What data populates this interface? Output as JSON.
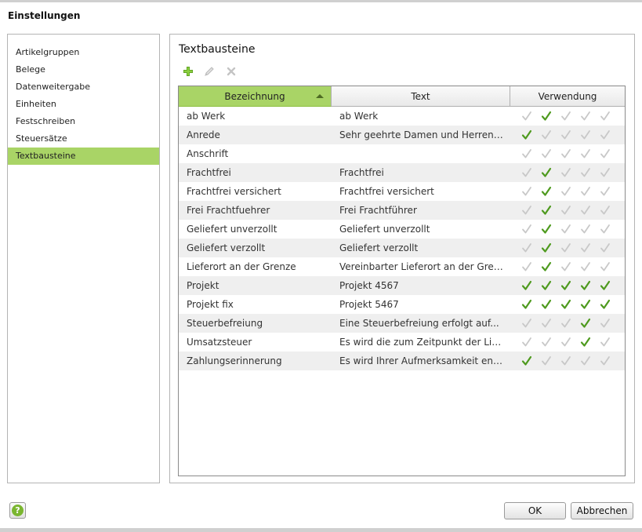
{
  "window": {
    "title": "Einstellungen"
  },
  "nav": {
    "items": [
      {
        "label": "Artikelgruppen",
        "active": false
      },
      {
        "label": "Belege",
        "active": false
      },
      {
        "label": "Datenweitergabe",
        "active": false
      },
      {
        "label": "Einheiten",
        "active": false
      },
      {
        "label": "Festschreiben",
        "active": false
      },
      {
        "label": "Steuersätze",
        "active": false
      },
      {
        "label": "Textbausteine",
        "active": true
      }
    ]
  },
  "section": {
    "title": "Textbausteine"
  },
  "toolbar": {
    "add_icon": "plus-icon",
    "edit_icon": "pencil-icon",
    "delete_icon": "x-icon"
  },
  "table": {
    "columns": [
      {
        "label": "Bezeichnung",
        "sorted": "asc"
      },
      {
        "label": "Text"
      },
      {
        "label": "Verwendung"
      }
    ],
    "rows": [
      {
        "name": "ab Werk",
        "text": "ab Werk",
        "usage": [
          false,
          true,
          false,
          false,
          false
        ]
      },
      {
        "name": "Anrede",
        "text": "Sehr geehrte Damen und Herren,...",
        "usage": [
          true,
          false,
          false,
          false,
          false
        ]
      },
      {
        "name": "Anschrift",
        "text": "",
        "usage": [
          false,
          false,
          false,
          false,
          false
        ]
      },
      {
        "name": "Frachtfrei",
        "text": "Frachtfrei",
        "usage": [
          false,
          true,
          false,
          false,
          false
        ]
      },
      {
        "name": "Frachtfrei versichert",
        "text": "Frachtfrei versichert",
        "usage": [
          false,
          true,
          false,
          false,
          false
        ]
      },
      {
        "name": "Frei Frachtfuehrer",
        "text": "Frei Frachtführer",
        "usage": [
          false,
          true,
          false,
          false,
          false
        ]
      },
      {
        "name": "Geliefert unverzollt",
        "text": "Geliefert unverzollt",
        "usage": [
          false,
          true,
          false,
          false,
          false
        ]
      },
      {
        "name": "Geliefert verzollt",
        "text": "Geliefert verzollt",
        "usage": [
          false,
          true,
          false,
          false,
          false
        ]
      },
      {
        "name": "Lieferort an der Grenze",
        "text": "Vereinbarter Lieferort an der Gren...",
        "usage": [
          false,
          true,
          false,
          false,
          false
        ]
      },
      {
        "name": "Projekt",
        "text": "Projekt 4567",
        "usage": [
          true,
          true,
          true,
          true,
          true
        ]
      },
      {
        "name": "Projekt fix",
        "text": "Projekt 5467",
        "usage": [
          true,
          true,
          true,
          true,
          true
        ]
      },
      {
        "name": "Steuerbefreiung",
        "text": "Eine Steuerbefreiung erfolgt auf...",
        "usage": [
          false,
          false,
          false,
          true,
          false
        ]
      },
      {
        "name": "Umsatzsteuer",
        "text": "Es wird die zum Zeitpunkt der Lief...",
        "usage": [
          false,
          false,
          false,
          true,
          false
        ]
      },
      {
        "name": "Zahlungserinnerung",
        "text": "Es wird Ihrer Aufmerksamkeit ent...",
        "usage": [
          true,
          false,
          false,
          false,
          false
        ]
      }
    ]
  },
  "footer": {
    "help_icon": "help-icon",
    "help_glyph": "?",
    "ok_label": "OK",
    "cancel_label": "Abbrechen"
  },
  "colors": {
    "accent": "#a9d466",
    "check_on": "#4e9a1e",
    "check_off": "#c8c8c8"
  }
}
